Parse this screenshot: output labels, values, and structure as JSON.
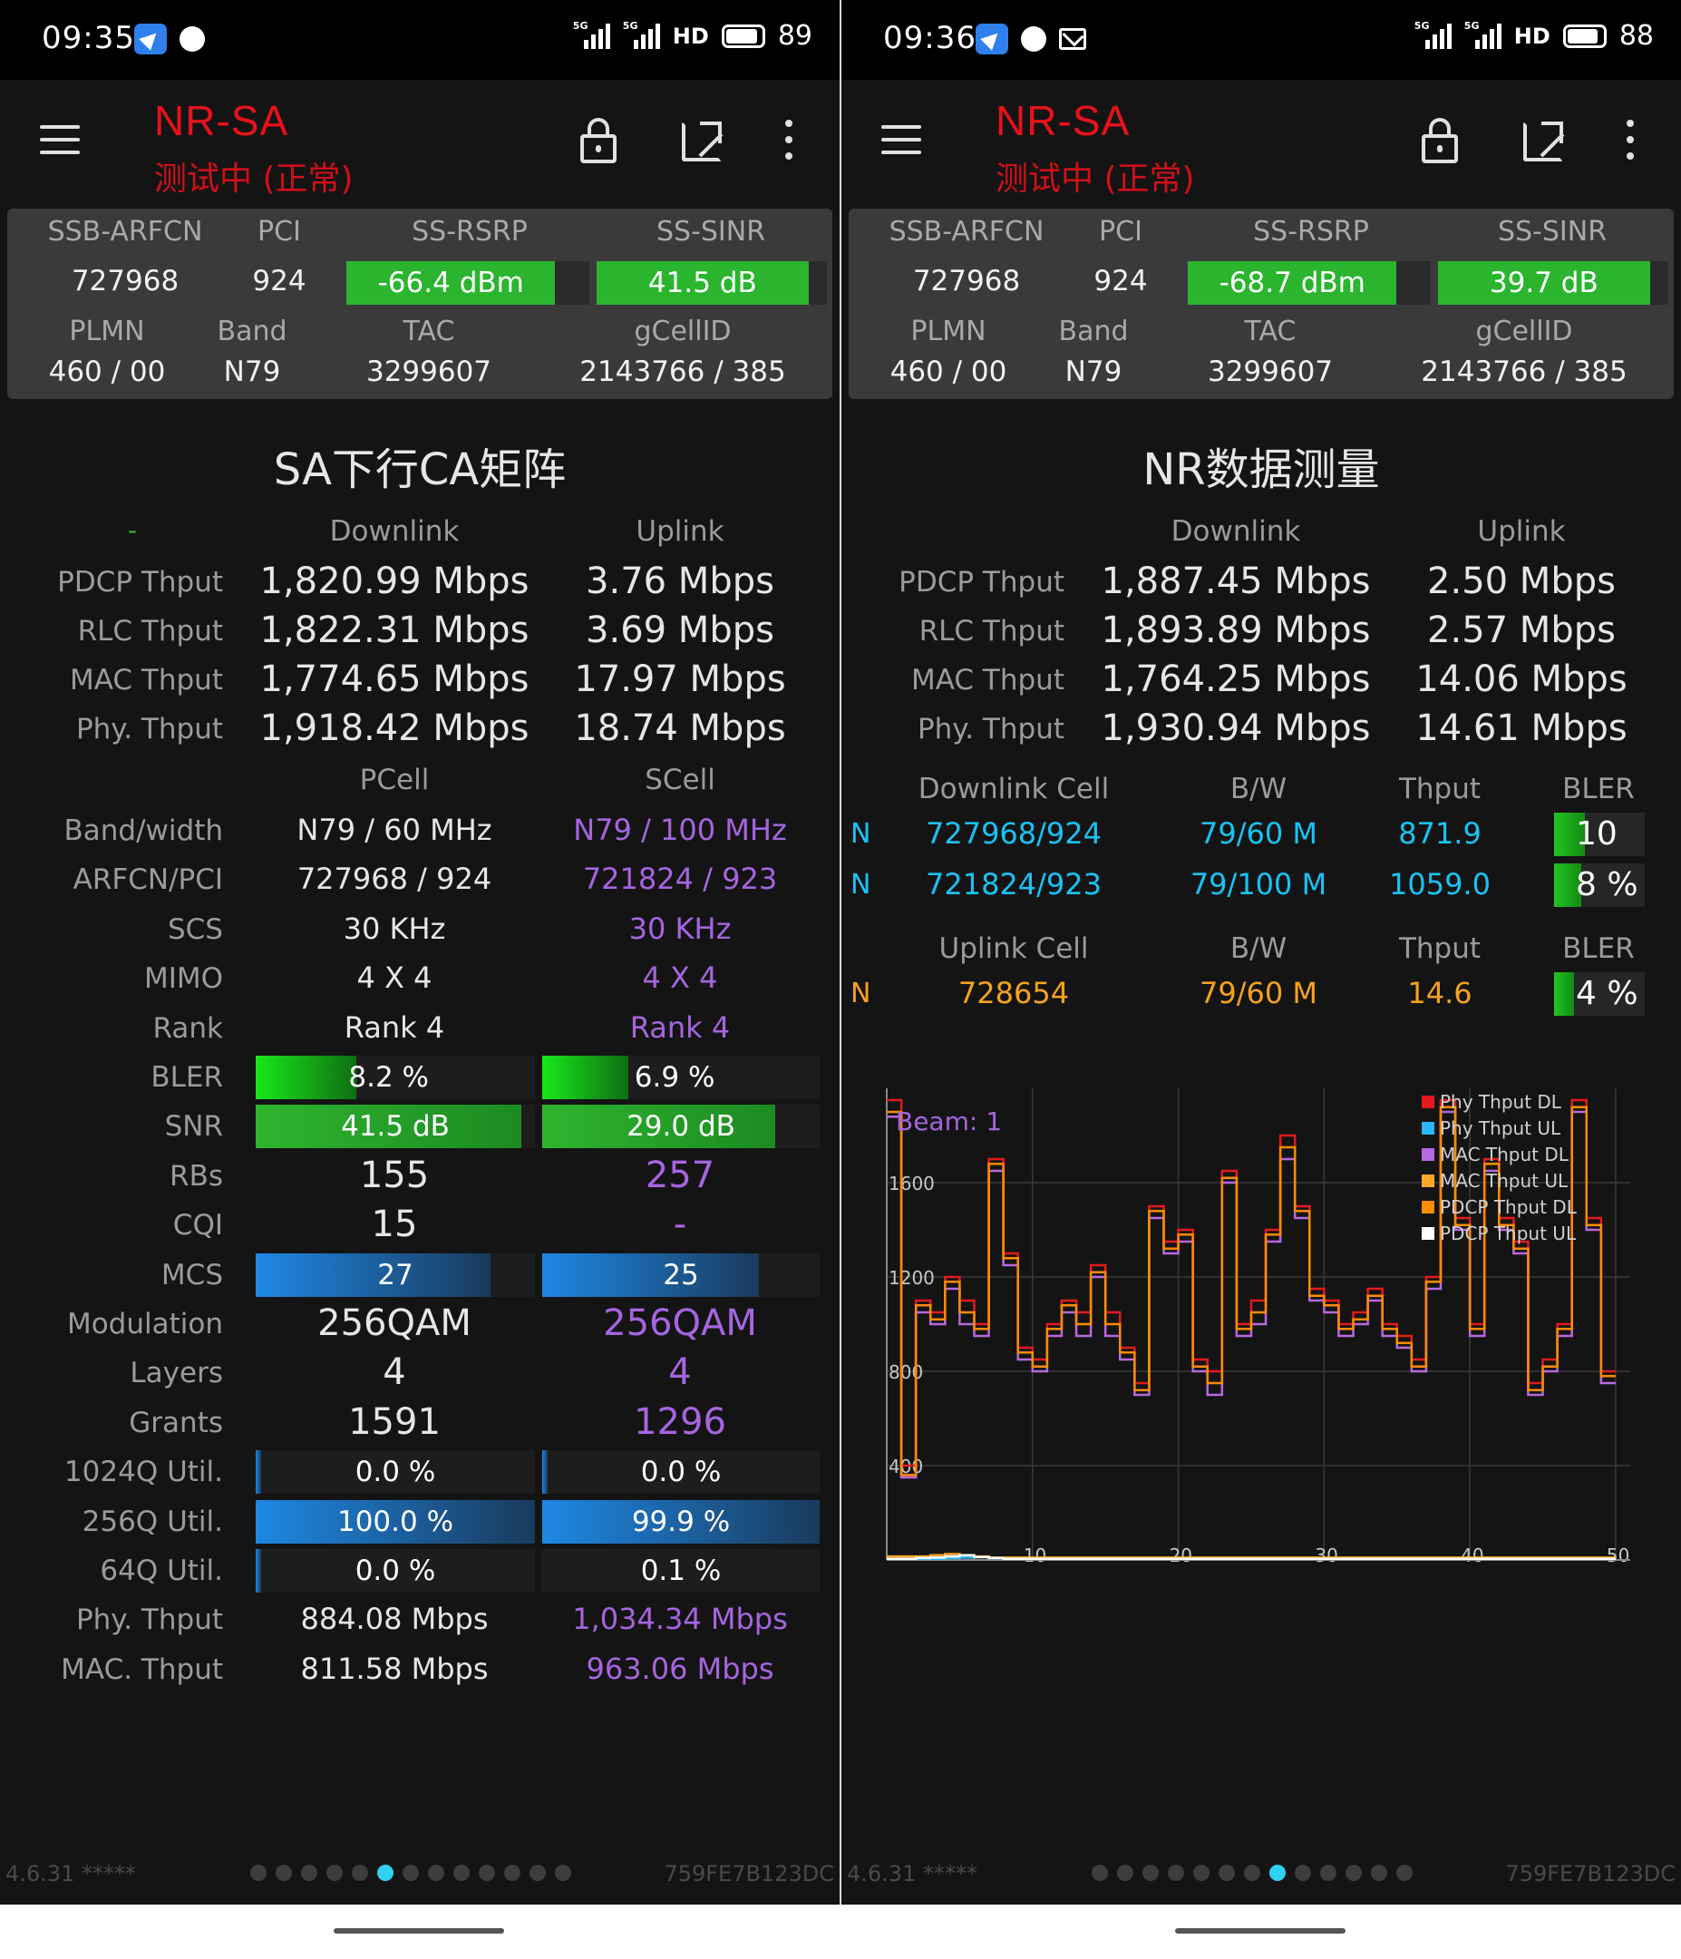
{
  "left": {
    "status": {
      "time": "09:35",
      "battery": "89",
      "hd": "HD",
      "net": "5G"
    },
    "app": {
      "title": "NR-SA",
      "subtitle": "测试中 (正常)"
    },
    "info": {
      "h_ssb": "SSB-ARFCN",
      "h_pci": "PCI",
      "h_rsrp": "SS-RSRP",
      "h_sinr": "SS-SINR",
      "ssb": "727968",
      "pci": "924",
      "rsrp": "-66.4 dBm",
      "rsrp_level": 0.86,
      "sinr": "41.5 dB",
      "sinr_level": 0.92,
      "h_plmn": "PLMN",
      "h_band": "Band",
      "h_tac": "TAC",
      "h_gcell": "gCellID",
      "plmn": "460 / 00",
      "band": "N79",
      "tac": "3299607",
      "gcell": "2143766 / 385"
    },
    "section_title": "SA下行CA矩阵",
    "thput": {
      "dash": "-",
      "h_dl": "Downlink",
      "h_ul": "Uplink",
      "rows": [
        {
          "label": "PDCP Thput",
          "dl": "1,820.99 Mbps",
          "ul": "3.76 Mbps"
        },
        {
          "label": "RLC Thput",
          "dl": "1,822.31 Mbps",
          "ul": "3.69 Mbps"
        },
        {
          "label": "MAC Thput",
          "dl": "1,774.65 Mbps",
          "ul": "17.97 Mbps"
        },
        {
          "label": "Phy. Thput",
          "dl": "1,918.42 Mbps",
          "ul": "18.74 Mbps"
        }
      ]
    },
    "cells": {
      "h_p": "PCell",
      "h_s": "SCell",
      "bandwidth": {
        "label": "Band/width",
        "p": "N79 / 60 MHz",
        "s": "N79 / 100 MHz"
      },
      "arfcn": {
        "label": "ARFCN/PCI",
        "p": "727968 / 924",
        "s": "721824 / 923"
      },
      "scs": {
        "label": "SCS",
        "p": "30 KHz",
        "s": "30 KHz"
      },
      "mimo": {
        "label": "MIMO",
        "p": "4 X 4",
        "s": "4 X 4"
      },
      "rank": {
        "label": "Rank",
        "p": "Rank 4",
        "s": "Rank 4"
      },
      "bler": {
        "label": "BLER",
        "p": "8.2 %",
        "s": "6.9 %",
        "p_level": 0.36,
        "s_level": 0.31
      },
      "snr": {
        "label": "SNR",
        "p": "41.5 dB",
        "s": "29.0 dB",
        "p_level": 0.95,
        "s_level": 0.84
      },
      "rbs": {
        "label": "RBs",
        "p": "155",
        "s": "257"
      },
      "cqi": {
        "label": "CQI",
        "p": "15",
        "s": "-"
      },
      "mcs": {
        "label": "MCS",
        "p": "27",
        "s": "25",
        "p_level": 0.84,
        "s_level": 0.78
      },
      "mod": {
        "label": "Modulation",
        "p": "256QAM",
        "s": "256QAM"
      },
      "layers": {
        "label": "Layers",
        "p": "4",
        "s": "4"
      },
      "grants": {
        "label": "Grants",
        "p": "1591",
        "s": "1296"
      },
      "u1024": {
        "label": "1024Q Util.",
        "p": "0.0 %",
        "s": "0.0 %",
        "p_level": 0.0,
        "s_level": 0.0
      },
      "u256": {
        "label": "256Q Util.",
        "p": "100.0 %",
        "s": "99.9 %",
        "p_level": 1.0,
        "s_level": 0.999
      },
      "u64": {
        "label": "64Q Util.",
        "p": "0.0 %",
        "s": "0.1 %",
        "p_level": 0.0,
        "s_level": 0.001
      },
      "phy": {
        "label": "Phy. Thput",
        "p": "884.08 Mbps",
        "s": "1,034.34 Mbps"
      },
      "mac": {
        "label": "MAC. Thput",
        "p": "811.58 Mbps",
        "s": "963.06 Mbps"
      }
    },
    "footer": {
      "version": "4.6.31 *****",
      "device_id": "759FE7B123DC",
      "page_index": 5,
      "page_count": 13
    }
  },
  "right": {
    "status": {
      "time": "09:36",
      "battery": "88",
      "hd": "HD",
      "net": "5G"
    },
    "app": {
      "title": "NR-SA",
      "subtitle": "测试中 (正常)"
    },
    "info": {
      "h_ssb": "SSB-ARFCN",
      "h_pci": "PCI",
      "h_rsrp": "SS-RSRP",
      "h_sinr": "SS-SINR",
      "ssb": "727968",
      "pci": "924",
      "rsrp": "-68.7 dBm",
      "rsrp_level": 0.86,
      "sinr": "39.7 dB",
      "sinr_level": 0.92,
      "h_plmn": "PLMN",
      "h_band": "Band",
      "h_tac": "TAC",
      "h_gcell": "gCellID",
      "plmn": "460 / 00",
      "band": "N79",
      "tac": "3299607",
      "gcell": "2143766 / 385"
    },
    "section_title": "NR数据测量",
    "thput": {
      "h_dl": "Downlink",
      "h_ul": "Uplink",
      "rows": [
        {
          "label": "PDCP Thput",
          "dl": "1,887.45 Mbps",
          "ul": "2.50 Mbps"
        },
        {
          "label": "RLC Thput",
          "dl": "1,893.89 Mbps",
          "ul": "2.57 Mbps"
        },
        {
          "label": "MAC Thput",
          "dl": "1,764.25 Mbps",
          "ul": "14.06 Mbps"
        },
        {
          "label": "Phy. Thput",
          "dl": "1,930.94 Mbps",
          "ul": "14.61 Mbps"
        }
      ]
    },
    "dl_cells": {
      "h_cell": "Downlink Cell",
      "h_bw": "B/W",
      "h_thput": "Thput",
      "h_bler": "BLER",
      "rows": [
        {
          "tag": "N",
          "cell": "727968/924",
          "bw": "79/60 M",
          "thput": "871.9",
          "bler": "10 %",
          "bler_level": 0.34
        },
        {
          "tag": "N",
          "cell": "721824/923",
          "bw": "79/100 M",
          "thput": "1059.0",
          "bler": "8 %",
          "bler_level": 0.3
        }
      ]
    },
    "ul_cells": {
      "h_cell": "Uplink Cell",
      "h_bw": "B/W",
      "h_thput": "Thput",
      "h_bler": "BLER",
      "rows": [
        {
          "tag": "N",
          "cell": "728654",
          "bw": "79/60 M",
          "thput": "14.6",
          "bler": "4 %",
          "bler_level": 0.22
        }
      ]
    },
    "chart_data": {
      "type": "line",
      "annotation": "Beam: 1",
      "x": [
        0,
        1,
        2,
        3,
        4,
        5,
        6,
        7,
        8,
        9,
        10,
        11,
        12,
        13,
        14,
        15,
        16,
        17,
        18,
        19,
        20,
        21,
        22,
        23,
        24,
        25,
        26,
        27,
        28,
        29,
        30,
        31,
        32,
        33,
        34,
        35,
        36,
        37,
        38,
        39,
        40,
        41,
        42,
        43,
        44,
        45,
        46,
        47,
        48,
        49
      ],
      "xticks": [
        10,
        20,
        30,
        40,
        50
      ],
      "yticks": [
        400,
        800,
        1200,
        1600
      ],
      "ylim": [
        0,
        2000
      ],
      "xlim": [
        0,
        51
      ],
      "grid": true,
      "legend_position": "top-right",
      "colors": {
        "phy_dl": "#e31a1c",
        "phy_ul": "#29b6f6",
        "mac_dl": "#b868e0",
        "mac_ul": "#ffa726",
        "pdcp_dl": "#ff8c00",
        "pdcp_ul": "#ffffff"
      },
      "series": [
        {
          "name": "Phy Thput DL",
          "values": [
            1950,
            400,
            1100,
            1050,
            1200,
            1100,
            1000,
            1700,
            1300,
            900,
            850,
            1000,
            1100,
            1050,
            1250,
            1050,
            900,
            750,
            1500,
            1350,
            1400,
            850,
            800,
            1650,
            1000,
            1100,
            1400,
            1800,
            1500,
            1150,
            1100,
            1000,
            1050,
            1150,
            1000,
            950,
            850,
            1200,
            1950,
            1450,
            1000,
            1700,
            1450,
            1350,
            750,
            850,
            1000,
            1950,
            1450,
            800
          ]
        },
        {
          "name": "Phy Thput UL",
          "values": [
            5,
            5,
            5,
            5,
            8,
            10,
            12,
            8,
            5,
            5,
            5,
            5,
            5,
            5,
            5,
            5,
            5,
            5,
            5,
            5,
            5,
            5,
            5,
            5,
            5,
            5,
            5,
            5,
            5,
            5,
            5,
            5,
            5,
            5,
            5,
            5,
            5,
            5,
            5,
            5,
            5,
            5,
            5,
            5,
            5,
            5,
            5,
            5,
            5,
            5
          ]
        },
        {
          "name": "MAC Thput DL",
          "values": [
            1880,
            350,
            1050,
            1000,
            1150,
            1000,
            950,
            1650,
            1250,
            850,
            800,
            950,
            1050,
            950,
            1200,
            950,
            850,
            700,
            1450,
            1300,
            1350,
            800,
            700,
            1600,
            950,
            1000,
            1350,
            1700,
            1450,
            1100,
            1050,
            950,
            1000,
            1100,
            950,
            900,
            800,
            1150,
            1900,
            1400,
            950,
            1650,
            1400,
            1300,
            700,
            800,
            950,
            1900,
            1400,
            750
          ]
        },
        {
          "name": "MAC Thput UL",
          "values": [
            15,
            15,
            15,
            20,
            25,
            15,
            15,
            10,
            10,
            10,
            10,
            10,
            10,
            10,
            10,
            10,
            10,
            10,
            10,
            10,
            10,
            10,
            10,
            10,
            10,
            10,
            10,
            10,
            10,
            10,
            10,
            10,
            10,
            10,
            10,
            10,
            10,
            10,
            10,
            10,
            10,
            10,
            10,
            10,
            10,
            10,
            10,
            10,
            10,
            10
          ]
        },
        {
          "name": "PDCP Thput DL",
          "values": [
            1900,
            360,
            1080,
            1020,
            1180,
            1050,
            980,
            1680,
            1280,
            880,
            820,
            980,
            1080,
            1000,
            1220,
            1000,
            880,
            720,
            1480,
            1320,
            1380,
            820,
            750,
            1620,
            980,
            1050,
            1380,
            1750,
            1480,
            1120,
            1080,
            980,
            1020,
            1120,
            980,
            920,
            820,
            1180,
            1920,
            1420,
            980,
            1680,
            1420,
            1320,
            720,
            820,
            980,
            1920,
            1420,
            780
          ]
        },
        {
          "name": "PDCP Thput UL",
          "values": [
            5,
            5,
            8,
            10,
            15,
            20,
            12,
            8,
            5,
            5,
            5,
            5,
            5,
            5,
            5,
            5,
            5,
            5,
            5,
            5,
            5,
            5,
            5,
            5,
            5,
            5,
            5,
            5,
            5,
            5,
            5,
            5,
            5,
            5,
            5,
            5,
            5,
            5,
            5,
            5,
            5,
            5,
            5,
            5,
            5,
            5,
            5,
            5,
            5,
            5
          ]
        }
      ]
    },
    "footer": {
      "version": "4.6.31 *****",
      "device_id": "759FE7B123DC",
      "page_index": 7,
      "page_count": 13
    }
  }
}
